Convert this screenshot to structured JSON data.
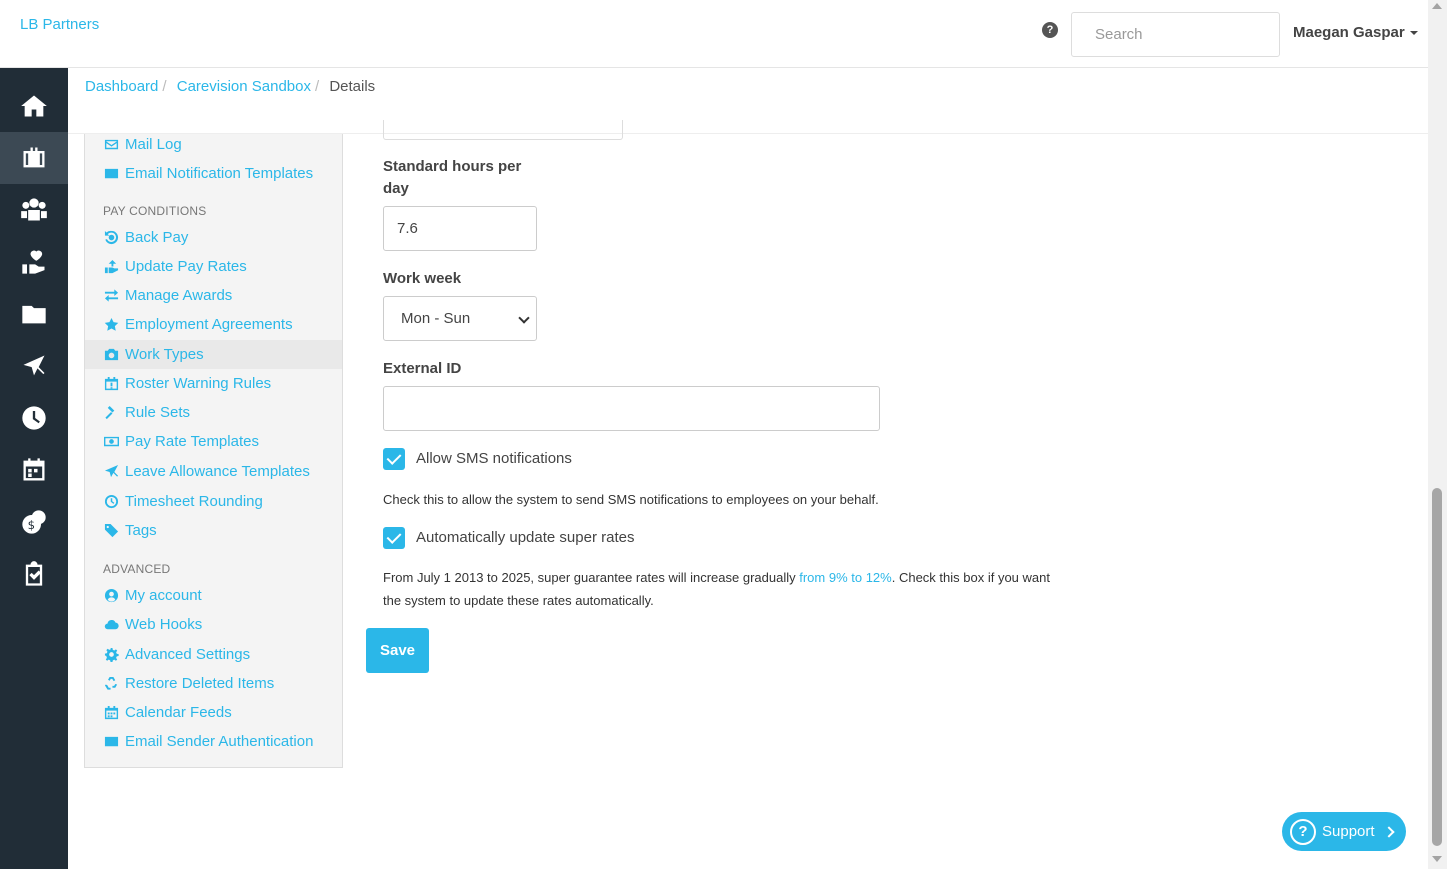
{
  "header": {
    "brand": "LB Partners",
    "search_placeholder": "Search",
    "user_name": "Maegan Gaspar"
  },
  "breadcrumb": {
    "items": [
      "Dashboard",
      "Carevision Sandbox"
    ],
    "current": "Details"
  },
  "settings_menu": {
    "items_top": [
      {
        "label": "Mail Log",
        "icon": "envelope-outline-icon"
      },
      {
        "label": "Email Notification Templates",
        "icon": "envelope-template-icon"
      }
    ],
    "pay_conditions_heading": "PAY CONDITIONS",
    "pay_conditions": [
      {
        "label": "Back Pay",
        "icon": "back-pay-icon"
      },
      {
        "label": "Update Pay Rates",
        "icon": "update-rates-icon"
      },
      {
        "label": "Manage Awards",
        "icon": "exchange-icon"
      },
      {
        "label": "Employment Agreements",
        "icon": "star-icon"
      },
      {
        "label": "Work Types",
        "icon": "camera-icon"
      },
      {
        "label": "Roster Warning Rules",
        "icon": "calendar-warning-icon"
      },
      {
        "label": "Rule Sets",
        "icon": "gavel-icon"
      },
      {
        "label": "Pay Rate Templates",
        "icon": "money-icon"
      },
      {
        "label": "Leave Allowance Templates",
        "icon": "plane-icon"
      },
      {
        "label": "Timesheet Rounding",
        "icon": "clock-icon"
      },
      {
        "label": "Tags",
        "icon": "tag-icon"
      }
    ],
    "advanced_heading": "ADVANCED",
    "advanced": [
      {
        "label": "My account",
        "icon": "user-circle-icon"
      },
      {
        "label": "Web Hooks",
        "icon": "cloud-icon"
      },
      {
        "label": "Advanced Settings",
        "icon": "gear-icon"
      },
      {
        "label": "Restore Deleted Items",
        "icon": "recycle-icon"
      },
      {
        "label": "Calendar Feeds",
        "icon": "calendar-icon"
      },
      {
        "label": "Email Sender Authentication",
        "icon": "envelope-icon"
      }
    ]
  },
  "form": {
    "std_hours_label": "Standard hours per day",
    "std_hours_value": "7.6",
    "work_week_label": "Work week",
    "work_week_value": "Mon - Sun",
    "external_id_label": "External ID",
    "external_id_value": "",
    "sms_label": "Allow SMS notifications",
    "sms_checked": true,
    "sms_help": "Check this to allow the system to send SMS notifications to employees on your behalf.",
    "super_label": "Automatically update super rates",
    "super_checked": true,
    "super_help_1": "From July 1 2013 to 2025, super guarantee rates will increase gradually ",
    "super_help_link": "from 9% to 12%",
    "super_help_2": ". Check this box if you want the system to update these rates automatically.",
    "save_label": "Save"
  },
  "support": {
    "label": "Support"
  },
  "colors": {
    "accent": "#2bb7e8",
    "sidebar_bg": "#212d37"
  }
}
